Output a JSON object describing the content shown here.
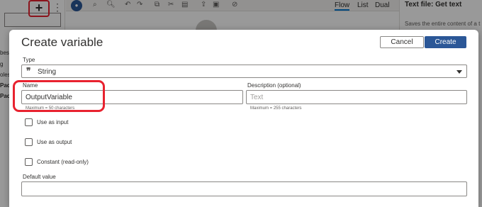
{
  "background": {
    "toolbar": {
      "add_icon": "plus-icon",
      "add_glyph": "+",
      "more_glyph": "⋮",
      "view_tabs": [
        {
          "label": "Flow",
          "active": true
        },
        {
          "label": "List",
          "active": false
        },
        {
          "label": "Dual",
          "active": false
        }
      ]
    },
    "left_items": [
      "bes",
      "g",
      "oles",
      "Pac",
      "Pac"
    ],
    "right_panel": {
      "title": "Text file: Get text",
      "description": "Saves the entire content of a t"
    }
  },
  "dialog": {
    "title": "Create variable",
    "cancel_label": "Cancel",
    "create_label": "Create",
    "type": {
      "label": "Type",
      "icon": "quote-icon",
      "icon_glyph": "❞",
      "value": "String"
    },
    "name": {
      "label": "Name",
      "value": "OutputVariable",
      "placeholder": "",
      "hint": "Maximum = 50 characters"
    },
    "description": {
      "label": "Description (optional)",
      "value": "",
      "placeholder": "Text",
      "hint": "Maximum = 255 characters"
    },
    "options": [
      {
        "label": "Use as input",
        "checked": false
      },
      {
        "label": "Use as output",
        "checked": false
      },
      {
        "label": "Constant (read-only)",
        "checked": false
      }
    ],
    "default_value": {
      "label": "Default value",
      "value": ""
    }
  },
  "colors": {
    "accent": "#2b5797",
    "annotation_red": "#e8222f",
    "overlay": "rgba(0,0,0,0.4)"
  }
}
